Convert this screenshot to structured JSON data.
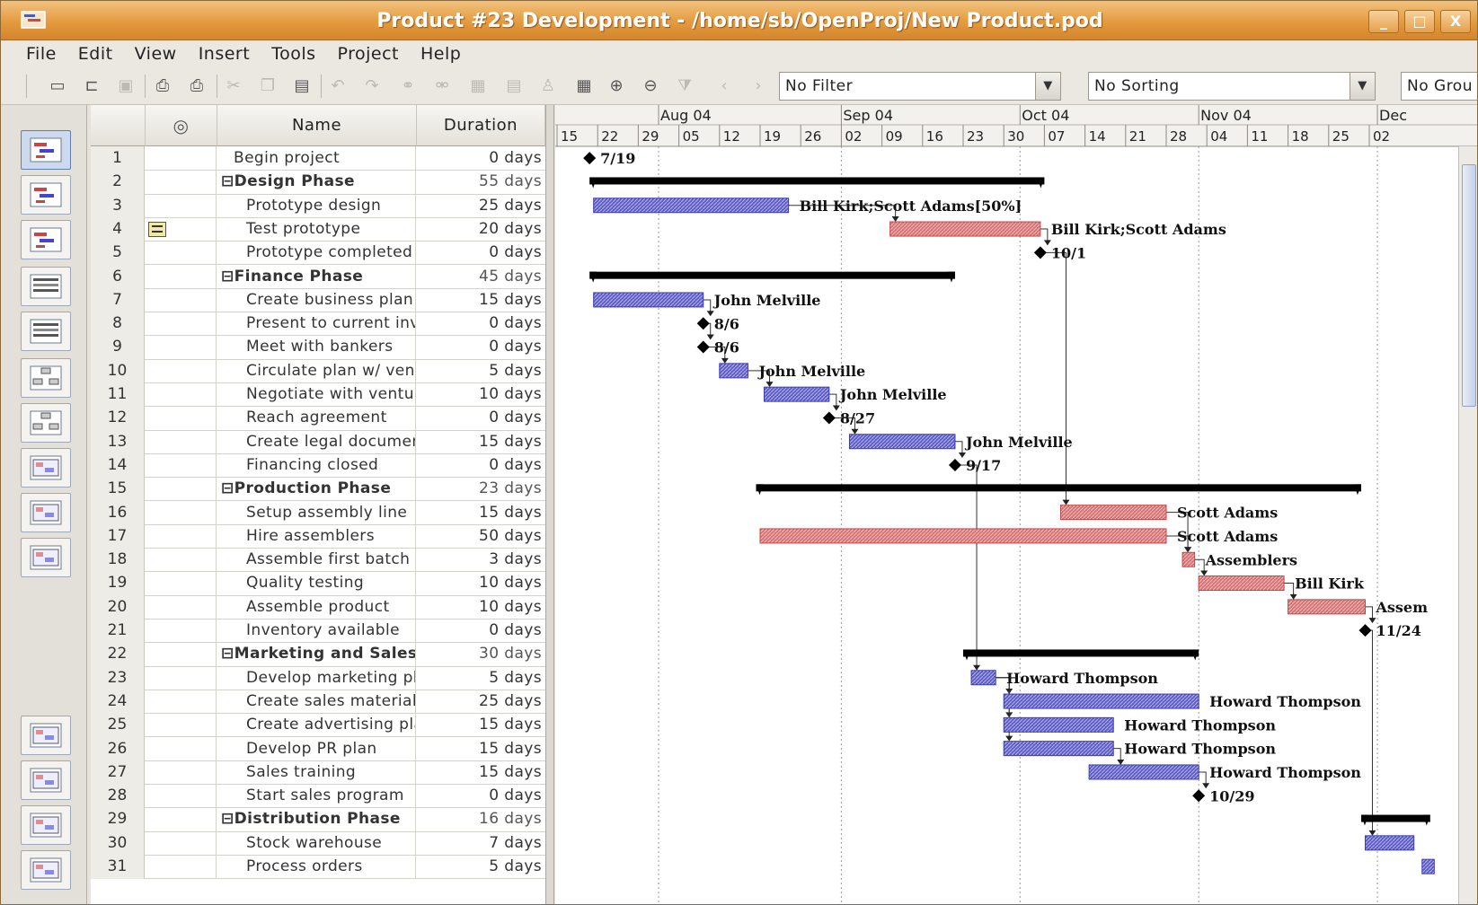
{
  "window": {
    "title": "Product #23 Development - /home/sb/OpenProj/New Product.pod",
    "buttons": [
      "_",
      "□",
      "X"
    ]
  },
  "menu": [
    "File",
    "Edit",
    "View",
    "Insert",
    "Tools",
    "Project",
    "Help"
  ],
  "toolbar": {
    "filter": "No Filter",
    "sorting": "No Sorting",
    "grouping": "No Grou"
  },
  "views": [
    "gantt-view",
    "tracking-gantt-view",
    "task-usage-view",
    "resource-view",
    "resource-usage-view",
    "network-view",
    "wbs-view",
    "calendar-view",
    "task-form-view",
    "resource-form-view",
    "histogram-view",
    "chart-view",
    "report-view",
    "project-view"
  ],
  "table": {
    "headers": {
      "id": "",
      "indicators": "◎",
      "name": "Name",
      "duration": "Duration"
    },
    "rows": [
      {
        "id": "1",
        "name": "Begin project",
        "duration": "0 days",
        "summary": false,
        "indent": 1
      },
      {
        "id": "2",
        "name": "⊟Design Phase",
        "duration": "55 days",
        "summary": true,
        "indent": 0
      },
      {
        "id": "3",
        "name": "Prototype design",
        "duration": "25 days",
        "summary": false,
        "indent": 2
      },
      {
        "id": "4",
        "name": "Test prototype",
        "duration": "20 days",
        "summary": false,
        "indent": 2,
        "note": true
      },
      {
        "id": "5",
        "name": "Prototype completed",
        "duration": "0 days",
        "summary": false,
        "indent": 2
      },
      {
        "id": "6",
        "name": "⊟Finance Phase",
        "duration": "45 days",
        "summary": true,
        "indent": 0
      },
      {
        "id": "7",
        "name": "Create business plan",
        "duration": "15 days",
        "summary": false,
        "indent": 2
      },
      {
        "id": "8",
        "name": "Present to current inve",
        "duration": "0 days",
        "summary": false,
        "indent": 2
      },
      {
        "id": "9",
        "name": "Meet with bankers",
        "duration": "0 days",
        "summary": false,
        "indent": 2
      },
      {
        "id": "10",
        "name": "Circulate plan w/ vent",
        "duration": "5 days",
        "summary": false,
        "indent": 2
      },
      {
        "id": "11",
        "name": "Negotiate with venture",
        "duration": "10 days",
        "summary": false,
        "indent": 2
      },
      {
        "id": "12",
        "name": "Reach agreement",
        "duration": "0 days",
        "summary": false,
        "indent": 2
      },
      {
        "id": "13",
        "name": "Create legal document",
        "duration": "15 days",
        "summary": false,
        "indent": 2
      },
      {
        "id": "14",
        "name": "Financing closed",
        "duration": "0 days",
        "summary": false,
        "indent": 2
      },
      {
        "id": "15",
        "name": "⊟Production Phase",
        "duration": "23 days",
        "summary": true,
        "indent": 0
      },
      {
        "id": "16",
        "name": "Setup assembly line",
        "duration": "15 days",
        "summary": false,
        "indent": 2
      },
      {
        "id": "17",
        "name": "Hire assemblers",
        "duration": "50 days",
        "summary": false,
        "indent": 2
      },
      {
        "id": "18",
        "name": "Assemble first batch",
        "duration": "3 days",
        "summary": false,
        "indent": 2
      },
      {
        "id": "19",
        "name": "Quality testing",
        "duration": "10 days",
        "summary": false,
        "indent": 2
      },
      {
        "id": "20",
        "name": "Assemble product",
        "duration": "10 days",
        "summary": false,
        "indent": 2
      },
      {
        "id": "21",
        "name": "Inventory available",
        "duration": "0 days",
        "summary": false,
        "indent": 2
      },
      {
        "id": "22",
        "name": "⊟Marketing and Sales P",
        "duration": "30 days",
        "summary": true,
        "indent": 0
      },
      {
        "id": "23",
        "name": "Develop marketing pla",
        "duration": "5 days",
        "summary": false,
        "indent": 2
      },
      {
        "id": "24",
        "name": "Create sales materials",
        "duration": "25 days",
        "summary": false,
        "indent": 2
      },
      {
        "id": "25",
        "name": "Create advertising pla",
        "duration": "15 days",
        "summary": false,
        "indent": 2
      },
      {
        "id": "26",
        "name": "Develop PR plan",
        "duration": "15 days",
        "summary": false,
        "indent": 2
      },
      {
        "id": "27",
        "name": "Sales training",
        "duration": "15 days",
        "summary": false,
        "indent": 2
      },
      {
        "id": "28",
        "name": "Start sales program",
        "duration": "0 days",
        "summary": false,
        "indent": 2
      },
      {
        "id": "29",
        "name": "⊟Distribution Phase",
        "duration": "16 days",
        "summary": true,
        "indent": 0
      },
      {
        "id": "30",
        "name": "Stock warehouse",
        "duration": "7 days",
        "summary": false,
        "indent": 2
      },
      {
        "id": "31",
        "name": "Process orders",
        "duration": "5 days",
        "summary": false,
        "indent": 2
      }
    ]
  },
  "gantt": {
    "months": [
      "Aug 04",
      "Sep 04",
      "Oct 04",
      "Nov 04",
      "Dec"
    ],
    "days": [
      "15",
      "22",
      "29",
      "05",
      "12",
      "19",
      "26",
      "02",
      "09",
      "16",
      "23",
      "30",
      "07",
      "14",
      "21",
      "28",
      "04",
      "11",
      "18",
      "25",
      "02"
    ],
    "colors": {
      "normal": "#5a5ad6",
      "critical": "#e66a6a",
      "summary": "#000000"
    },
    "bars": [
      {
        "row": 1,
        "type": "milestone",
        "start": 0.8,
        "label": "7/19"
      },
      {
        "row": 2,
        "type": "summary",
        "start": 0.8,
        "end": 12.0
      },
      {
        "row": 3,
        "type": "task",
        "crit": false,
        "start": 0.9,
        "end": 5.7,
        "label": "Bill Kirk;Scott Adams[50%]"
      },
      {
        "row": 4,
        "type": "task",
        "crit": true,
        "start": 8.2,
        "end": 11.9,
        "label": "Bill Kirk;Scott Adams"
      },
      {
        "row": 5,
        "type": "milestone",
        "start": 11.9,
        "label": "10/1"
      },
      {
        "row": 6,
        "type": "summary",
        "start": 0.8,
        "end": 9.8
      },
      {
        "row": 7,
        "type": "task",
        "crit": false,
        "start": 0.9,
        "end": 3.6,
        "label": "John Melville"
      },
      {
        "row": 8,
        "type": "milestone",
        "start": 3.6,
        "label": "8/6"
      },
      {
        "row": 9,
        "type": "milestone",
        "start": 3.6,
        "label": "8/6"
      },
      {
        "row": 10,
        "type": "task",
        "crit": false,
        "start": 4.0,
        "end": 4.7,
        "label": "John Melville"
      },
      {
        "row": 11,
        "type": "task",
        "crit": false,
        "start": 5.1,
        "end": 6.7,
        "label": "John Melville"
      },
      {
        "row": 12,
        "type": "milestone",
        "start": 6.7,
        "label": "8/27"
      },
      {
        "row": 13,
        "type": "task",
        "crit": false,
        "start": 7.2,
        "end": 9.8,
        "label": "John Melville"
      },
      {
        "row": 14,
        "type": "milestone",
        "start": 9.8,
        "label": "9/17"
      },
      {
        "row": 15,
        "type": "summary",
        "start": 4.9,
        "end": 19.8
      },
      {
        "row": 16,
        "type": "task",
        "crit": true,
        "start": 12.4,
        "end": 15.0,
        "label": "Scott Adams"
      },
      {
        "row": 17,
        "type": "task",
        "crit": true,
        "start": 5.0,
        "end": 15.0,
        "label": "Scott Adams"
      },
      {
        "row": 18,
        "type": "task",
        "crit": true,
        "start": 15.4,
        "end": 15.7,
        "label": "Assemblers"
      },
      {
        "row": 19,
        "type": "task",
        "crit": true,
        "start": 15.8,
        "end": 17.9,
        "label": "Bill Kirk"
      },
      {
        "row": 20,
        "type": "task",
        "crit": true,
        "start": 18.0,
        "end": 19.9,
        "label": "Assem"
      },
      {
        "row": 21,
        "type": "milestone",
        "start": 19.9,
        "label": "11/24"
      },
      {
        "row": 22,
        "type": "summary",
        "start": 10.0,
        "end": 15.8
      },
      {
        "row": 23,
        "type": "task",
        "crit": false,
        "start": 10.2,
        "end": 10.8,
        "label": "Howard Thompson"
      },
      {
        "row": 24,
        "type": "task",
        "crit": false,
        "start": 11.0,
        "end": 15.8,
        "label": "Howard Thompson"
      },
      {
        "row": 25,
        "type": "task",
        "crit": false,
        "start": 11.0,
        "end": 13.7,
        "label": "Howard Thompson"
      },
      {
        "row": 26,
        "type": "task",
        "crit": false,
        "start": 11.0,
        "end": 13.7,
        "label": "Howard Thompson"
      },
      {
        "row": 27,
        "type": "task",
        "crit": false,
        "start": 13.1,
        "end": 15.8,
        "label": "Howard Thompson"
      },
      {
        "row": 28,
        "type": "milestone",
        "start": 15.8,
        "label": "10/29"
      },
      {
        "row": 29,
        "type": "summary",
        "start": 19.8,
        "end": 21.5
      },
      {
        "row": 30,
        "type": "task",
        "crit": false,
        "start": 19.9,
        "end": 21.1,
        "label": ""
      },
      {
        "row": 31,
        "type": "task",
        "crit": false,
        "start": 21.3,
        "end": 21.6,
        "label": ""
      }
    ]
  }
}
